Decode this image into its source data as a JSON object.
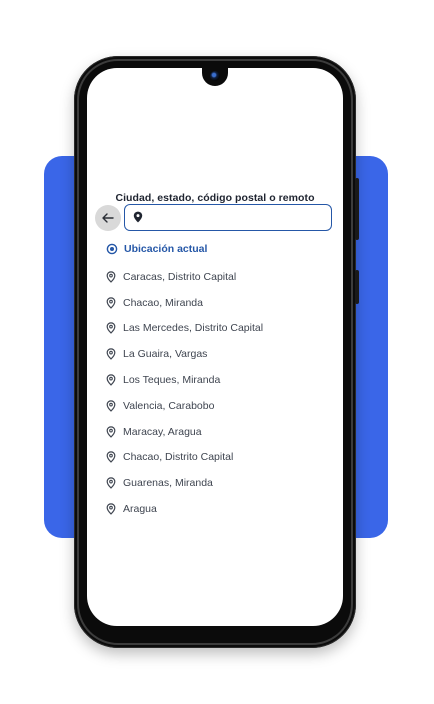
{
  "screen": {
    "heading": "Ciudad, estado, código postal o remoto",
    "search": {
      "value": "",
      "placeholder": ""
    },
    "current_location": {
      "label": "Ubicación actual",
      "icon": "target-icon"
    },
    "suggestions": [
      {
        "label": "Caracas, Distrito Capital",
        "icon": "location-pin-icon"
      },
      {
        "label": "Chacao, Miranda",
        "icon": "location-pin-icon"
      },
      {
        "label": "Las Mercedes, Distrito Capital",
        "icon": "location-pin-icon"
      },
      {
        "label": "La Guaira, Vargas",
        "icon": "location-pin-icon"
      },
      {
        "label": "Los Teques, Miranda",
        "icon": "location-pin-icon"
      },
      {
        "label": "Valencia, Carabobo",
        "icon": "location-pin-icon"
      },
      {
        "label": "Maracay, Aragua",
        "icon": "location-pin-icon"
      },
      {
        "label": "Chacao, Distrito Capital",
        "icon": "location-pin-icon"
      },
      {
        "label": "Guarenas, Miranda",
        "icon": "location-pin-icon"
      },
      {
        "label": "Aragua",
        "icon": "location-pin-icon"
      }
    ]
  },
  "colors": {
    "accent": "#2557a7",
    "backdrop_panel": "#3a66e8",
    "phone_body": "#0b0b0b",
    "text_primary": "#1f2430",
    "text_secondary": "#3f4550",
    "back_button_bg": "#d9d9d9"
  }
}
